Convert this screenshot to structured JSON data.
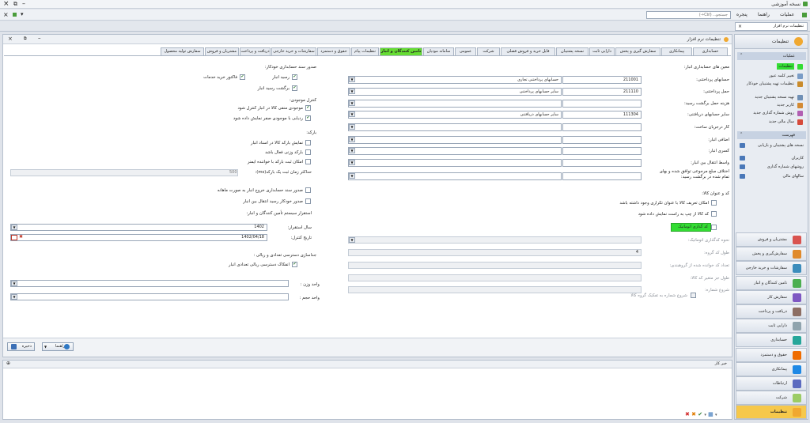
{
  "window": {
    "title": "نسخه آموزشی",
    "close": "×",
    "restore": "⧉",
    "minimize": "–"
  },
  "menubar": {
    "search_placeholder": "جستجو... (Ctrl+-)",
    "help": "راهنما",
    "window": "پنجره",
    "operations": "عملیات"
  },
  "doc_tab": {
    "label": "تنظیمات نرم افزار",
    "close": "×"
  },
  "panel": {
    "title": "تنظیمات نرم افزار"
  },
  "tabs": [
    "حسابداری",
    "پیمانکاری",
    "سفارش گیری و پخش",
    "دارایی ثابت",
    "نسخه پشتیبان",
    "فایل خرید و فروش فصلی",
    "شرکت",
    "عمومی",
    "سامانه مودیان",
    "تامین کنندگان و انبار",
    "تنظیمات پیام",
    "حقوق و دستمزد",
    "سفارشات و خرید خارجی",
    "دریافت و پرداخت",
    "مشتریان و فروش",
    "سفارش تولید محصول"
  ],
  "active_tab": "تامین کنندگان و انبار",
  "right_col": {
    "heading": "معین های حسابداری انبار:",
    "rows": [
      {
        "label": "حسابهای پرداختنی:",
        "code": "211001",
        "name": "حسابهای پرداختنی تجاری"
      },
      {
        "label": "حمل پرداختنی:",
        "code": "211110",
        "name": "سایر حسابهای پرداختنی"
      },
      {
        "label": "هزینه حمل برگشت رسید:",
        "code": "",
        "name": ""
      },
      {
        "label": "سایر حسابهای دریافتنی:",
        "code": "111304",
        "name": "سایر حسابهای دریافتنی"
      },
      {
        "label": "کار درجریان ساخت:",
        "code": "",
        "name": ""
      },
      {
        "label": "اضافی انبار:",
        "code": "",
        "name": ""
      },
      {
        "label": "کسری انبار:",
        "code": "",
        "name": ""
      },
      {
        "label": "واسط انتقال بین انبار:",
        "code": "",
        "name": ""
      },
      {
        "label": "اختلاف مبلغ مرجوعی توافق شده و بهای تمام شده در برگشت رسید:",
        "code": "",
        "name": ""
      }
    ],
    "code_heading": "کد و عنوان کالا:",
    "code_checks": [
      "امکان تعریف کالا با عنوان تکراری وجود داشته باشد",
      "کد کالا از چپ به راست نمایش داده شود"
    ],
    "auto_code_label": "کد گذاری اتوماتیک",
    "auto_fields": [
      {
        "label": "نحوه کدگذاری اتوماتیک:",
        "value": ""
      },
      {
        "label": "طول کد گروه:",
        "value": "4"
      },
      {
        "label": "تعداد کد خوانده شده از گروهبندی:",
        "value": ""
      },
      {
        "label": "طول جز متغیر کد کالا:",
        "value": ""
      },
      {
        "label": "شروع شماره:",
        "value": ""
      }
    ],
    "start_check": "شروع شماره به تفکیک گروه کالا"
  },
  "left_col": {
    "voucher_heading": "صدور سند حسابداری خودکار:",
    "voucher_checks": [
      "رسید انبار",
      "فاکتور خرید خدمات",
      "برگشت رسید انبار"
    ],
    "stock_heading": "کنترل موجودی:",
    "stock_checks": [
      "موجودی منفی کالا در انبار کنترل شود",
      "ردیابی با موجودی صفر نمایش داده شود"
    ],
    "barcode_heading": "بارکد:",
    "barcode_checks": [
      "نمایش بارکد کالا در اسناد انبار",
      "بارکد وزنی فعال باشد",
      "امکان ثبت بارکد با خواننده ایمنر"
    ],
    "barcode_time_label": "حداکثر زمان ثبت یک بارکد(ms):",
    "barcode_time_value": "500",
    "exit_check": "صدور سند حسابداری خروج انبار به صورت ماهانه",
    "transfer_check": "صدور خودکار رسید انتقال بین انبار",
    "system_label": "استقرار سیستم تأمین کنندگان و انبار:",
    "fiscal_year_label": "سال استقرار:",
    "fiscal_year_value": "1402",
    "control_date_label": "تاریخ کنترل:",
    "control_date_value": "1402/04/18",
    "dual_heading": "جداسازی دسترسی تعدادی و ریالی :",
    "dual_check": "انفکاک دسترسی ریالی تعدادی انبار",
    "weight_label": "واحد وزن :",
    "volume_label": "واحد حجم :"
  },
  "footer": {
    "save": "ذخیره",
    "help": "راهنما"
  },
  "messages": {
    "title": "خبر کار",
    "pin": "⊕"
  },
  "sidebar": {
    "title": "تنظیمات",
    "ops_heading": "عملیات",
    "ops": [
      "تنظیمات",
      "تغییر کلمه عبور",
      "تنظیمات تهیه پشتیبان خودکار",
      "تهیه نسخه پشتیبان جدید",
      "کاربر جدید",
      "روش شماره گذاری جدید",
      "سال مالی جدید"
    ],
    "list_heading": "فهرست",
    "list": [
      "نسخه های پشتیبان و بازیابی",
      "کاربران",
      "روشهای شماره گذاری",
      "سالهای مالی"
    ],
    "modules": [
      "مشتریان و فروش",
      "سفارش‌گیری و پخش",
      "سفارشات و خرید خارجی",
      "تامین کنندگان و انبار",
      "سفارش کار",
      "دریافت و پرداخت",
      "دارایی ثابت",
      "حسابداری",
      "حقوق و دستمزد",
      "پیمانکاری",
      "ارتباطات",
      "شرکت",
      "تنظیمات"
    ],
    "active_module": "تنظیمات"
  },
  "colors": {
    "active_tab": "#66dd33",
    "active_module": "#f6c84b",
    "green_label": "#33dd33"
  }
}
